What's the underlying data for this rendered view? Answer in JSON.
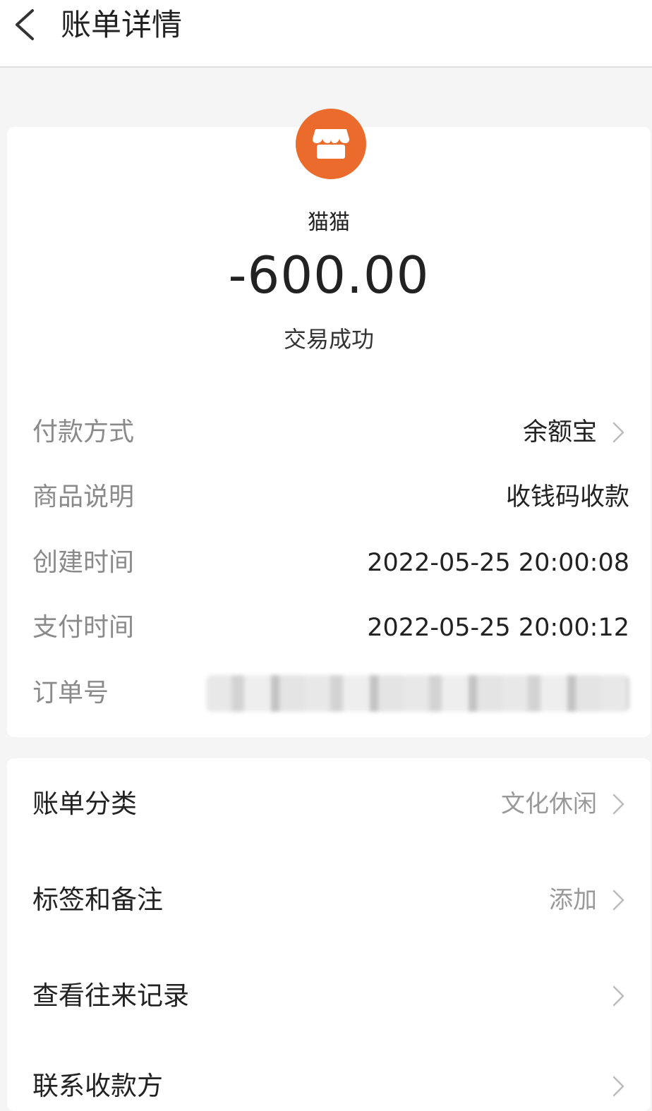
{
  "header": {
    "title": "账单详情",
    "back_icon": "chevron-left-icon"
  },
  "transaction": {
    "merchant_icon": "shop-icon",
    "merchant_color": "#ea6b2c",
    "merchant_name": "猫猫",
    "amount": "-600.00",
    "status": "交易成功"
  },
  "details": [
    {
      "label": "付款方式",
      "value": "余额宝"
    },
    {
      "label": "商品说明",
      "value": "收钱码收款"
    },
    {
      "label": "创建时间",
      "value": "2022-05-25 20:00:08"
    },
    {
      "label": "支付时间",
      "value": "2022-05-25 20:00:12"
    },
    {
      "label": "订单号",
      "value": ""
    }
  ],
  "actions": [
    {
      "label": "账单分类",
      "value": "文化休闲"
    },
    {
      "label": "标签和备注",
      "value": "添加"
    },
    {
      "label": "查看往来记录",
      "value": ""
    },
    {
      "label": "联系收款方",
      "value": ""
    }
  ]
}
